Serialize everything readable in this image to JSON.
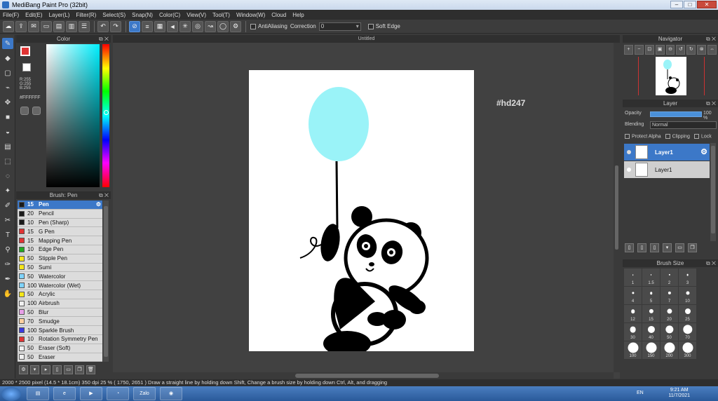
{
  "window": {
    "title": "MediBang Paint Pro (32bit)"
  },
  "menu": [
    "File(F)",
    "Edit(E)",
    "Layer(L)",
    "Filter(R)",
    "Select(S)",
    "Snap(N)",
    "Color(C)",
    "View(V)",
    "Tool(T)",
    "Window(W)",
    "Cloud",
    "Help"
  ],
  "toolbar": {
    "antialiasing_label": "AntiAliasing",
    "correction_label": "Correction",
    "correction_value": "0",
    "soft_edge_label": "Soft Edge"
  },
  "color_panel": {
    "title": "Color",
    "rgb_r": "R:255",
    "rgb_g": "G:255",
    "rgb_b": "B:255",
    "hex": "#FFFFFF",
    "fg_color": "#e03434"
  },
  "brush_panel": {
    "title": "Brush: Pen",
    "items": [
      {
        "size": "15",
        "name": "Pen",
        "color": "#1a1a1a"
      },
      {
        "size": "20",
        "name": "Pencil",
        "color": "#1a1a1a"
      },
      {
        "size": "10",
        "name": "Pen (Sharp)",
        "color": "#1a1a1a"
      },
      {
        "size": "15",
        "name": "G Pen",
        "color": "#e03434"
      },
      {
        "size": "15",
        "name": "Mapping Pen",
        "color": "#e03434"
      },
      {
        "size": "10",
        "name": "Edge Pen",
        "color": "#22a822"
      },
      {
        "size": "50",
        "name": "Stipple Pen",
        "color": "#f5e61a"
      },
      {
        "size": "50",
        "name": "Sumi",
        "color": "#f5e61a"
      },
      {
        "size": "50",
        "name": "Watercolor",
        "color": "#7fd3ff"
      },
      {
        "size": "100",
        "name": "Watercolor (Wet)",
        "color": "#7fd3ff"
      },
      {
        "size": "50",
        "name": "Acrylic",
        "color": "#f5e61a"
      },
      {
        "size": "100",
        "name": "Airbrush",
        "color": "#f0f0f0"
      },
      {
        "size": "50",
        "name": "Blur",
        "color": "#e8a0e8"
      },
      {
        "size": "70",
        "name": "Smudge",
        "color": "#ffd0a0"
      },
      {
        "size": "100",
        "name": "Sparkle Brush",
        "color": "#3a3ae0"
      },
      {
        "size": "10",
        "name": "Rotation Symmetry Pen",
        "color": "#e03434"
      },
      {
        "size": "50",
        "name": "Eraser (Soft)",
        "color": "#f0f0f0"
      },
      {
        "size": "50",
        "name": "Eraser",
        "color": "#f0f0f0"
      }
    ]
  },
  "document": {
    "title": "Untitled",
    "tag": "#hd247"
  },
  "navigator": {
    "title": "Navigator"
  },
  "layer_panel": {
    "title": "Layer",
    "opacity_label": "Opacity",
    "opacity_value": "100 %",
    "blending_label": "Blending",
    "blending_value": "Normal",
    "protect_alpha": "Protect Alpha",
    "clipping": "Clipping",
    "lock": "Lock",
    "layers": [
      {
        "name": "Layer1"
      },
      {
        "name": "Layer1"
      }
    ]
  },
  "brush_size_panel": {
    "title": "Brush Size",
    "sizes": [
      "1",
      "1.5",
      "2",
      "3",
      "4",
      "5",
      "7",
      "10",
      "12",
      "15",
      "20",
      "25",
      "30",
      "40",
      "50",
      "70",
      "100",
      "150",
      "200",
      "300"
    ]
  },
  "status": {
    "text": "2000 * 2500 pixel   (14.5 * 18.1cm)   350 dpi   25 %   ( 1750, 2651 )   Draw a straight line by holding down Shift, Change a brush size by holding down Ctrl, Alt, and dragging"
  },
  "taskbar": {
    "lang": "EN",
    "time": "9:21 AM",
    "date": "11/7/2021",
    "zalo": "Zalo"
  }
}
